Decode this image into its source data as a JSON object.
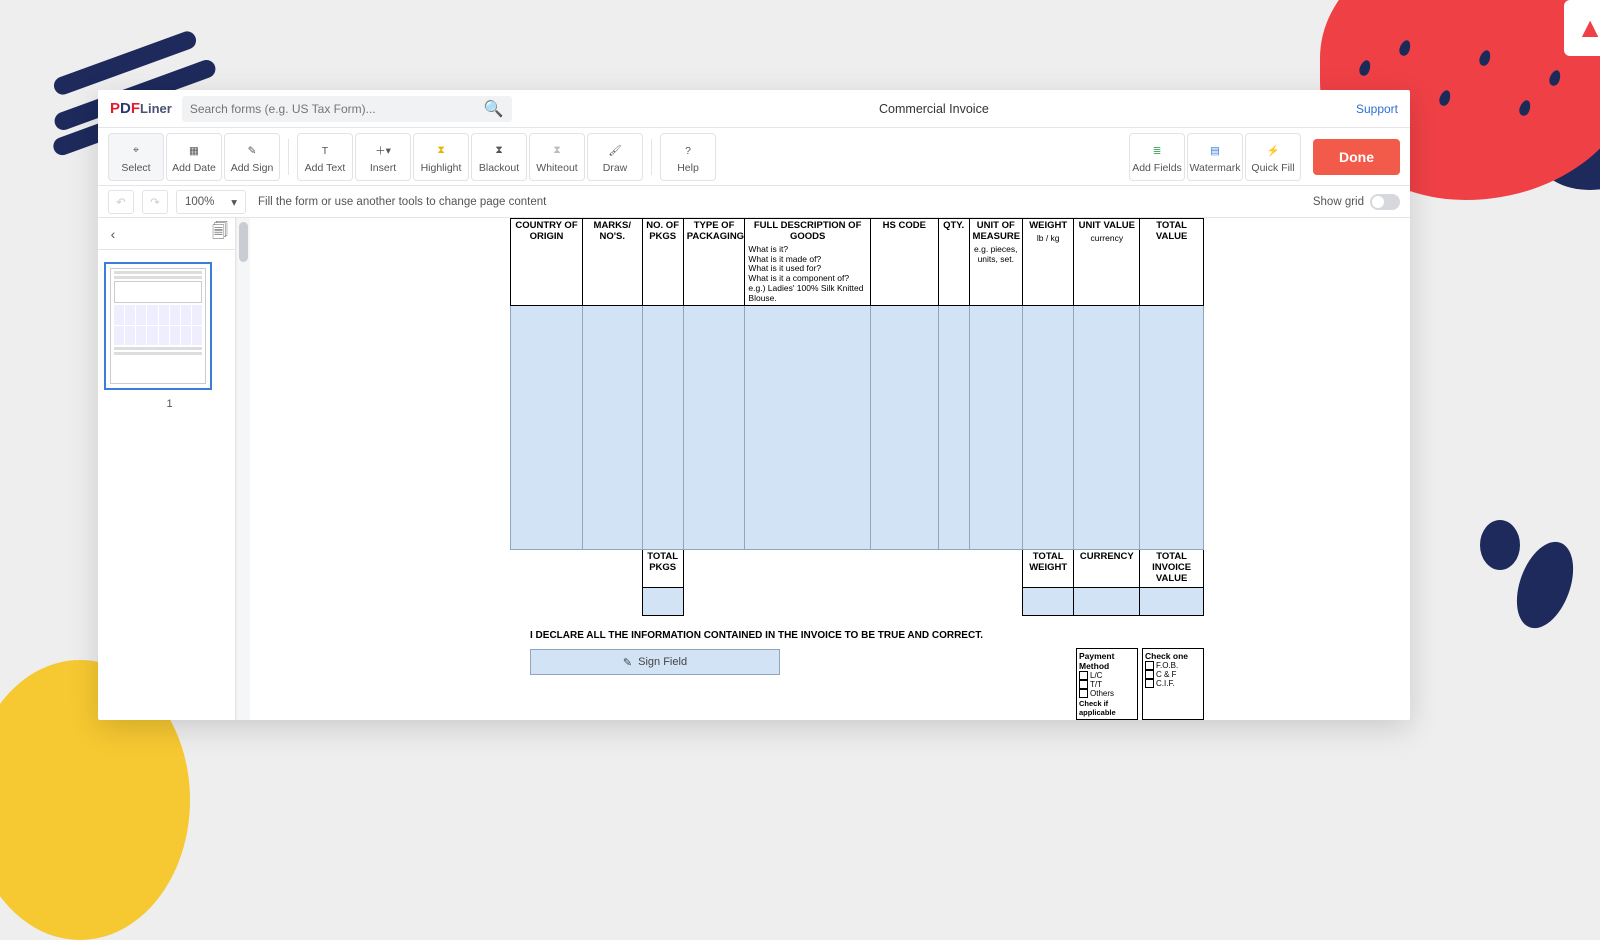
{
  "app_name": "PDFLiner",
  "search": {
    "placeholder": "Search forms (e.g. US Tax Form)..."
  },
  "document_title": "Commercial Invoice",
  "support_label": "Support",
  "toolbar": {
    "select": "Select",
    "add_date": "Add Date",
    "add_sign": "Add Sign",
    "add_text": "Add Text",
    "insert": "Insert",
    "highlight": "Highlight",
    "blackout": "Blackout",
    "whiteout": "Whiteout",
    "draw": "Draw",
    "help": "Help",
    "add_fields": "Add Fields",
    "watermark": "Watermark",
    "quick_fill": "Quick Fill",
    "done": "Done"
  },
  "subbar": {
    "zoom": "100%",
    "hint": "Fill the form or use another tools to change page content",
    "show_grid": "Show grid"
  },
  "pages": {
    "current_label": "1"
  },
  "invoice": {
    "columns": [
      "COUNTRY OF ORIGIN",
      "MARKS/ NO'S.",
      "NO. OF PKGS",
      "TYPE OF PACKAGING",
      "FULL DESCRIPTION OF GOODS",
      "HS CODE",
      "QTY.",
      "UNIT OF MEASURE",
      "WEIGHT",
      "UNIT VALUE",
      "TOTAL VALUE"
    ],
    "col_subs": {
      "full_desc": "What is it?\nWhat is it made of?\nWhat is it used for?\nWhat is it a component of?\ne.g.) Ladies' 100% Silk Knitted Blouse.",
      "uom": "e.g. pieces, units, set.",
      "weight": "lb / kg",
      "unit_value": "currency"
    },
    "totals": {
      "total_pkgs": "TOTAL PKGS",
      "total_weight": "TOTAL WEIGHT",
      "currency": "CURRENCY",
      "total_invoice": "TOTAL INVOICE VALUE"
    },
    "declaration": "I DECLARE ALL THE INFORMATION CONTAINED IN THE INVOICE TO BE TRUE AND CORRECT.",
    "sign_field": "Sign Field",
    "payment_method": {
      "header": "Payment Method",
      "options": [
        "L/C",
        "T/T",
        "Others"
      ],
      "footer": "Check if applicable"
    },
    "check_one": {
      "header": "Check one",
      "options": [
        "F.O.B.",
        "C & F",
        "C.I.F."
      ]
    }
  }
}
